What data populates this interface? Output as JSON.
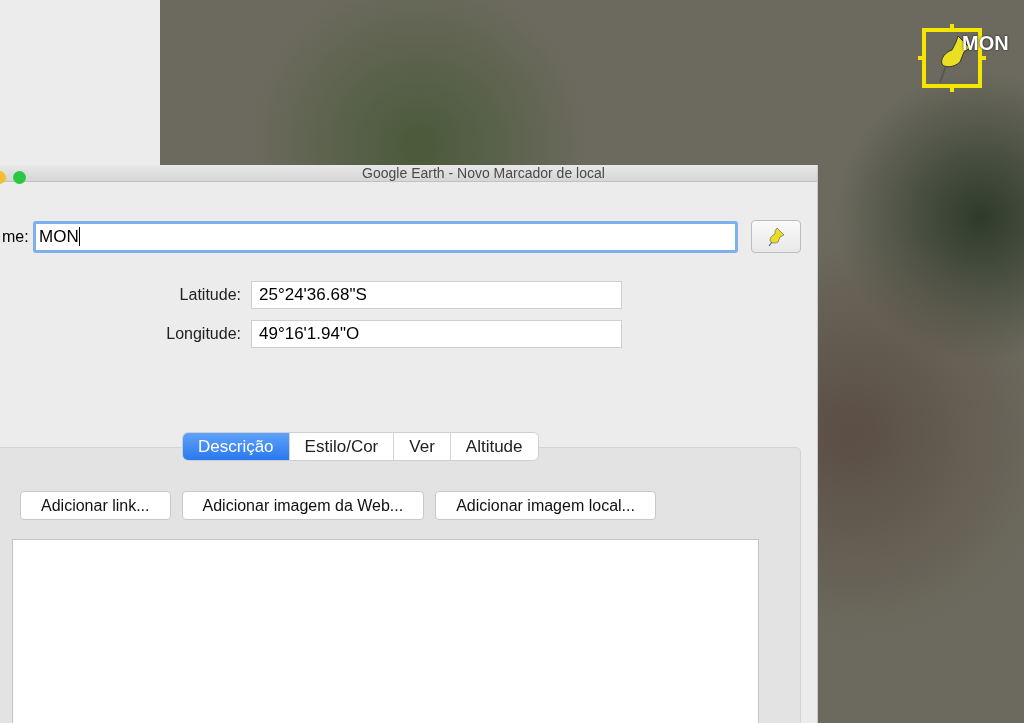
{
  "map": {
    "placemark_label": "MON"
  },
  "window": {
    "title": "Google Earth - Novo Marcador de local"
  },
  "name_field": {
    "label": "me:",
    "value": "MON"
  },
  "coordinates": [
    {
      "label": "Latitude:",
      "value": "25°24'36.68\"S"
    },
    {
      "label": "Longitude:",
      "value": "49°16'1.94\"O"
    }
  ],
  "tabs": [
    {
      "label": "Descrição",
      "selected": true
    },
    {
      "label": "Estilo/Cor",
      "selected": false
    },
    {
      "label": "Ver",
      "selected": false
    },
    {
      "label": "Altitude",
      "selected": false
    }
  ],
  "buttons": [
    "Adicionar link...",
    "Adicionar imagem da Web...",
    "Adicionar imagem local..."
  ]
}
